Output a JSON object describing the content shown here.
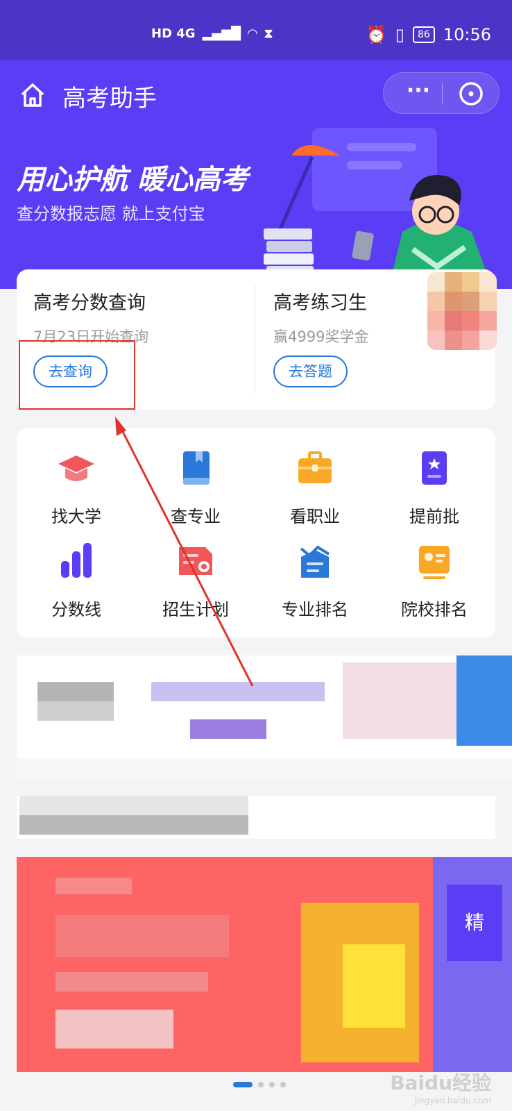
{
  "status_bar": {
    "network": "HD 4G",
    "battery": "86",
    "time": "10:56"
  },
  "nav": {
    "title": "高考助手",
    "more_label": "···"
  },
  "banner": {
    "slogan": "用心护航 暖心高考",
    "subslogan": "查分数报志愿 就上支付宝"
  },
  "entry_card": {
    "query": {
      "title": "高考分数查询",
      "subtitle": "7月23日开始查询",
      "button": "去查询"
    },
    "practice": {
      "title": "高考练习生",
      "subtitle": "赢4999奖学金",
      "button": "去答题"
    }
  },
  "features": [
    {
      "label": "找大学",
      "icon": "graduation-cap-icon",
      "color": "#f0565a"
    },
    {
      "label": "查专业",
      "icon": "book-icon",
      "color": "#2a78d8"
    },
    {
      "label": "看职业",
      "icon": "briefcase-icon",
      "color": "#f8a824"
    },
    {
      "label": "提前批",
      "icon": "certificate-scroll-icon",
      "color": "#5a3df5"
    },
    {
      "label": "分数线",
      "icon": "bar-chart-icon",
      "color": "#5a3df5"
    },
    {
      "label": "招生计划",
      "icon": "certificate-icon",
      "color": "#f0565a"
    },
    {
      "label": "专业排名",
      "icon": "ranking-icon",
      "color": "#2a78d8"
    },
    {
      "label": "院校排名",
      "icon": "id-card-icon",
      "color": "#f8a824"
    }
  ],
  "promo_banner": {
    "side_text": "精"
  },
  "watermark": {
    "brand": "Baidu经验",
    "domain": "jingyan.baidu.com"
  },
  "colors": {
    "brand_purple": "#5a3df5",
    "accent_blue": "#2a78d8",
    "annotation_red": "#e0312a"
  }
}
